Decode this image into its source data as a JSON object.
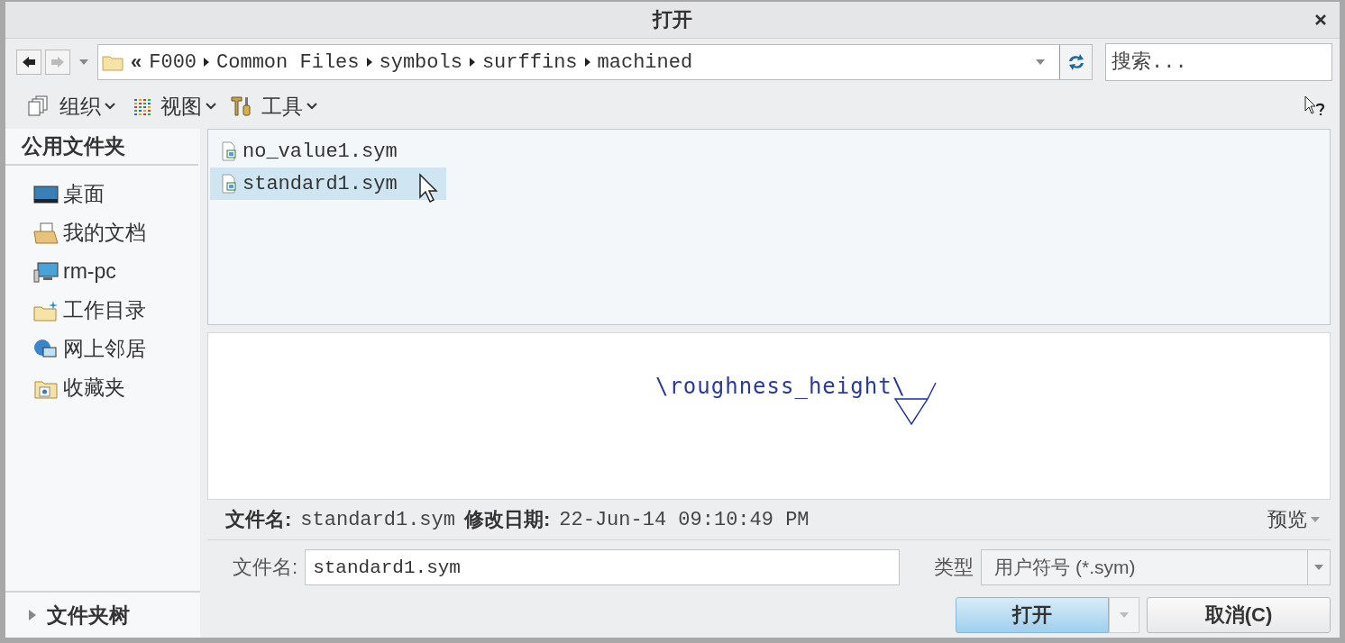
{
  "window": {
    "title": "打开"
  },
  "address": {
    "overflow": "«",
    "crumbs": [
      "F000",
      "Common Files",
      "symbols",
      "surffins",
      "machined"
    ]
  },
  "search": {
    "placeholder": "搜索..."
  },
  "toolbar": [
    {
      "label": "组织"
    },
    {
      "label": "视图"
    },
    {
      "label": "工具"
    }
  ],
  "sidebar": {
    "heading": "公用文件夹",
    "items": [
      {
        "label": "桌面"
      },
      {
        "label": "我的文档"
      },
      {
        "label": "rm-pc"
      },
      {
        "label": "工作目录"
      },
      {
        "label": "网上邻居"
      },
      {
        "label": "收藏夹"
      }
    ],
    "tree_toggle": "文件夹树",
    "tree_expanded": false
  },
  "files": [
    {
      "name": "no_value1.sym",
      "selected": false
    },
    {
      "name": "standard1.sym",
      "selected": true
    }
  ],
  "preview": {
    "symbol_text": "\\roughness_height\\"
  },
  "info": {
    "name_label": "文件名:",
    "name_value": "standard1.sym",
    "date_label": "修改日期:",
    "date_value": "22-Jun-14 09:10:49 PM",
    "preview_toggle": "预览"
  },
  "form": {
    "name_label": "文件名:",
    "name_value": "standard1.sym",
    "type_label": "类型",
    "type_value": "用户符号 (*.sym)"
  },
  "buttons": {
    "open": "打开",
    "cancel": "取消(C)"
  }
}
